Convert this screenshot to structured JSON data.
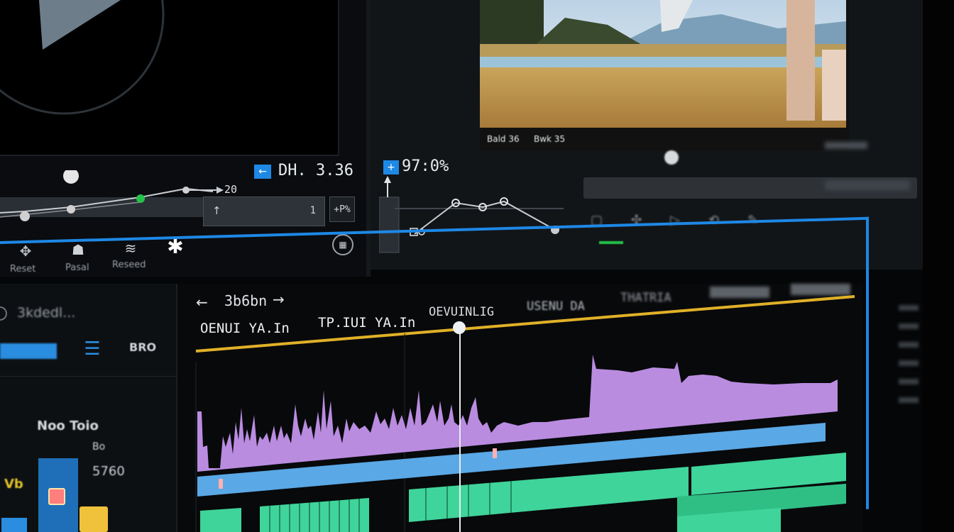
{
  "source_monitor": {
    "timecode": "DH. 3.36",
    "field_value": "1",
    "field_right": "+P%",
    "graph_label": "20",
    "tools": [
      "Reset",
      "Pasal",
      "Reseed",
      ""
    ]
  },
  "program_monitor": {
    "timecode": "97:0%",
    "caption_left": "Bald 36",
    "caption_mid": "Bwk 35",
    "graph_label": ""
  },
  "timeline": {
    "nav_label": "3b6bn",
    "track_headers": [
      "OENUI YA.In",
      "TP.IUI YA.In",
      "OEVUINLIG",
      "USENU DA",
      "THATRIA",
      "",
      ""
    ],
    "left_panel": {
      "title": "3kdedl...",
      "badge_text": "BRO",
      "rows": [
        "Noo Toio",
        "Bo",
        "5760",
        "Vb"
      ],
      "accent": "#2a8de0"
    }
  },
  "colors": {
    "accent_blue": "#1e88e5",
    "accent_yellow": "#e0b128",
    "audio_purple": "#b98ce0",
    "clip_blue": "#5aa8e6",
    "clip_green": "#3fd49a"
  }
}
